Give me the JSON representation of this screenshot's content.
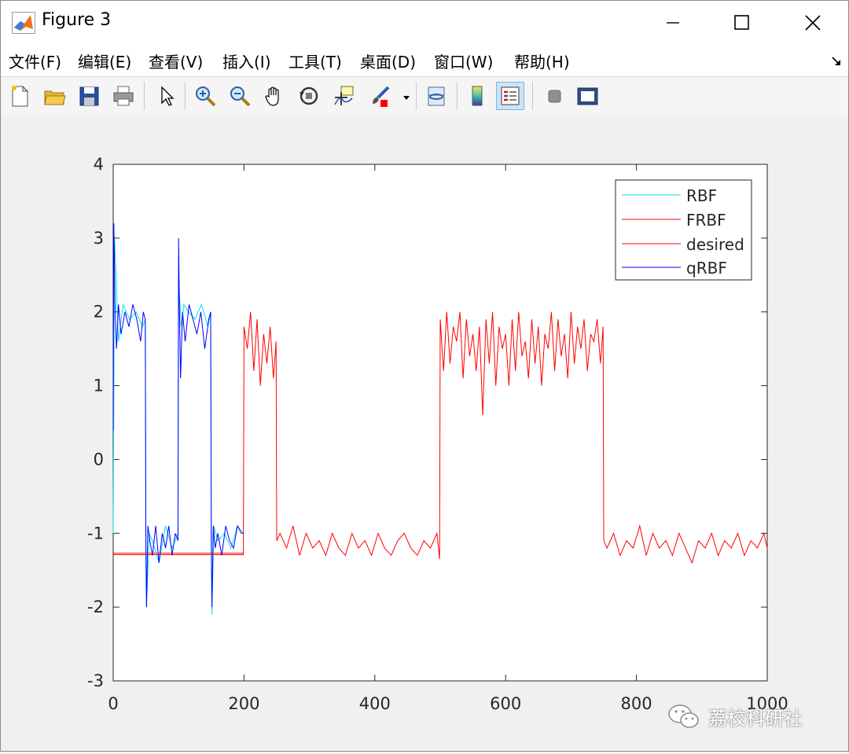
{
  "window": {
    "title": "Figure 3"
  },
  "menu": [
    "文件(F)",
    "编辑(E)",
    "查看(V)",
    "插入(I)",
    "工具(T)",
    "桌面(D)",
    "窗口(W)",
    "帮助(H)"
  ],
  "toolbar": [
    "new-figure-icon",
    "open-file-icon",
    "save-icon",
    "print-icon",
    "pointer-icon",
    "zoom-in-icon",
    "zoom-out-icon",
    "pan-hand-icon",
    "rotate-3d-icon",
    "data-cursor-icon",
    "brush-icon",
    "link-plot-icon",
    "colorbar-icon",
    "legend-icon",
    "hide-plot-tools-icon",
    "show-plot-tools-icon"
  ],
  "chart_data": {
    "type": "line",
    "title": "",
    "xlabel": "",
    "ylabel": "",
    "xlim": [
      0,
      1000
    ],
    "ylim": [
      -3,
      4
    ],
    "xticks": [
      "0",
      "200",
      "400",
      "600",
      "800",
      "1000"
    ],
    "yticks": [
      "-3",
      "-2",
      "-1",
      "0",
      "1",
      "2",
      "3",
      "4"
    ],
    "legend_position": "top-right",
    "grid": false,
    "series": [
      {
        "name": "RBF",
        "color": "#00e5e5",
        "x": [
          0,
          2,
          4,
          8,
          15,
          25,
          35,
          45,
          49,
          50,
          51,
          55,
          60,
          70,
          80,
          90,
          99,
          100,
          101,
          104,
          108,
          115,
          125,
          135,
          145,
          149,
          150,
          151,
          154,
          160,
          170,
          180,
          190,
          199
        ],
        "y": [
          -1.0,
          3.0,
          2.6,
          1.6,
          2.1,
          1.9,
          2.0,
          1.8,
          1.9,
          -1.3,
          -2.0,
          -1.0,
          -1.1,
          -1.4,
          -0.9,
          -1.2,
          -1.0,
          2.6,
          2.3,
          1.8,
          2.1,
          2.0,
          1.9,
          2.1,
          1.8,
          2.0,
          -1.2,
          -2.1,
          -0.9,
          -1.1,
          -1.0,
          -1.2,
          -0.9,
          -1.0
        ]
      },
      {
        "name": "FRBF",
        "color": "#ff0000",
        "x": [
          0,
          199
        ],
        "y": [
          -1.27,
          -1.27
        ]
      },
      {
        "name": "desired",
        "color": "#ff0000",
        "x": [
          0,
          199,
          200,
          205,
          210,
          215,
          220,
          225,
          230,
          235,
          240,
          245,
          249,
          250,
          255,
          265,
          275,
          285,
          295,
          305,
          315,
          325,
          335,
          345,
          355,
          365,
          375,
          385,
          395,
          405,
          415,
          425,
          435,
          445,
          455,
          465,
          475,
          485,
          495,
          499,
          500,
          505,
          510,
          515,
          520,
          525,
          530,
          535,
          540,
          545,
          550,
          555,
          560,
          565,
          570,
          575,
          580,
          585,
          590,
          595,
          600,
          605,
          610,
          615,
          620,
          625,
          630,
          635,
          640,
          645,
          650,
          655,
          660,
          665,
          670,
          675,
          680,
          685,
          690,
          695,
          700,
          705,
          710,
          715,
          720,
          725,
          730,
          735,
          740,
          745,
          749,
          750,
          755,
          765,
          775,
          785,
          795,
          805,
          815,
          825,
          835,
          845,
          855,
          865,
          875,
          885,
          895,
          905,
          915,
          925,
          935,
          945,
          955,
          965,
          975,
          985,
          995,
          1000
        ],
        "y": [
          -1.29,
          -1.29,
          1.8,
          1.5,
          2.0,
          1.2,
          1.9,
          1.0,
          1.7,
          1.3,
          1.8,
          1.1,
          1.6,
          -1.1,
          -1.0,
          -1.2,
          -0.9,
          -1.3,
          -1.0,
          -1.2,
          -1.1,
          -1.3,
          -1.0,
          -1.2,
          -1.3,
          -1.0,
          -1.2,
          -1.1,
          -1.3,
          -1.0,
          -1.2,
          -1.3,
          -1.1,
          -1.0,
          -1.2,
          -1.3,
          -1.1,
          -1.2,
          -1.0,
          -1.35,
          1.9,
          1.2,
          2.0,
          1.3,
          1.8,
          1.6,
          2.0,
          1.1,
          1.9,
          1.4,
          1.7,
          1.2,
          1.8,
          0.6,
          1.9,
          1.3,
          2.0,
          1.0,
          1.8,
          1.5,
          1.7,
          1.0,
          1.9,
          1.2,
          2.0,
          1.4,
          1.6,
          1.1,
          1.9,
          1.3,
          1.8,
          1.0,
          1.7,
          1.5,
          2.0,
          1.2,
          1.9,
          1.4,
          1.7,
          1.1,
          2.0,
          1.3,
          1.8,
          1.5,
          1.9,
          1.2,
          1.7,
          1.6,
          1.9,
          1.3,
          1.8,
          -1.1,
          -1.2,
          -1.0,
          -1.3,
          -1.1,
          -1.2,
          -0.9,
          -1.3,
          -1.0,
          -1.2,
          -1.1,
          -1.3,
          -1.0,
          -1.2,
          -1.4,
          -1.1,
          -1.2,
          -1.0,
          -1.3,
          -1.1,
          -1.2,
          -1.0,
          -1.3,
          -1.1,
          -1.2,
          -1.0,
          -1.2
        ]
      },
      {
        "name": "qRBF",
        "color": "#0000ff",
        "x": [
          0,
          1,
          3,
          5,
          8,
          12,
          18,
          24,
          30,
          36,
          42,
          46,
          49,
          50,
          51,
          53,
          56,
          60,
          65,
          70,
          75,
          80,
          85,
          90,
          95,
          99,
          100,
          101,
          103,
          106,
          110,
          116,
          122,
          128,
          134,
          140,
          146,
          149,
          150,
          151,
          153,
          156,
          160,
          166,
          172,
          178,
          184,
          190,
          196,
          199
        ],
        "y": [
          0.4,
          3.2,
          2.0,
          1.5,
          2.1,
          1.7,
          2.0,
          1.8,
          2.1,
          1.9,
          1.6,
          2.0,
          1.9,
          -1.2,
          -2.0,
          -0.9,
          -1.1,
          -1.3,
          -0.9,
          -1.4,
          -1.0,
          -1.2,
          -0.9,
          -1.3,
          -1.0,
          -1.1,
          3.0,
          2.2,
          1.1,
          2.0,
          1.6,
          2.1,
          1.9,
          1.7,
          2.0,
          1.5,
          1.9,
          2.0,
          -1.1,
          -2.0,
          -0.9,
          -1.2,
          -1.0,
          -1.3,
          -0.9,
          -1.1,
          -1.2,
          -0.9,
          -1.0,
          -1.0
        ]
      }
    ]
  },
  "watermark": {
    "text": "荔校科研社"
  }
}
